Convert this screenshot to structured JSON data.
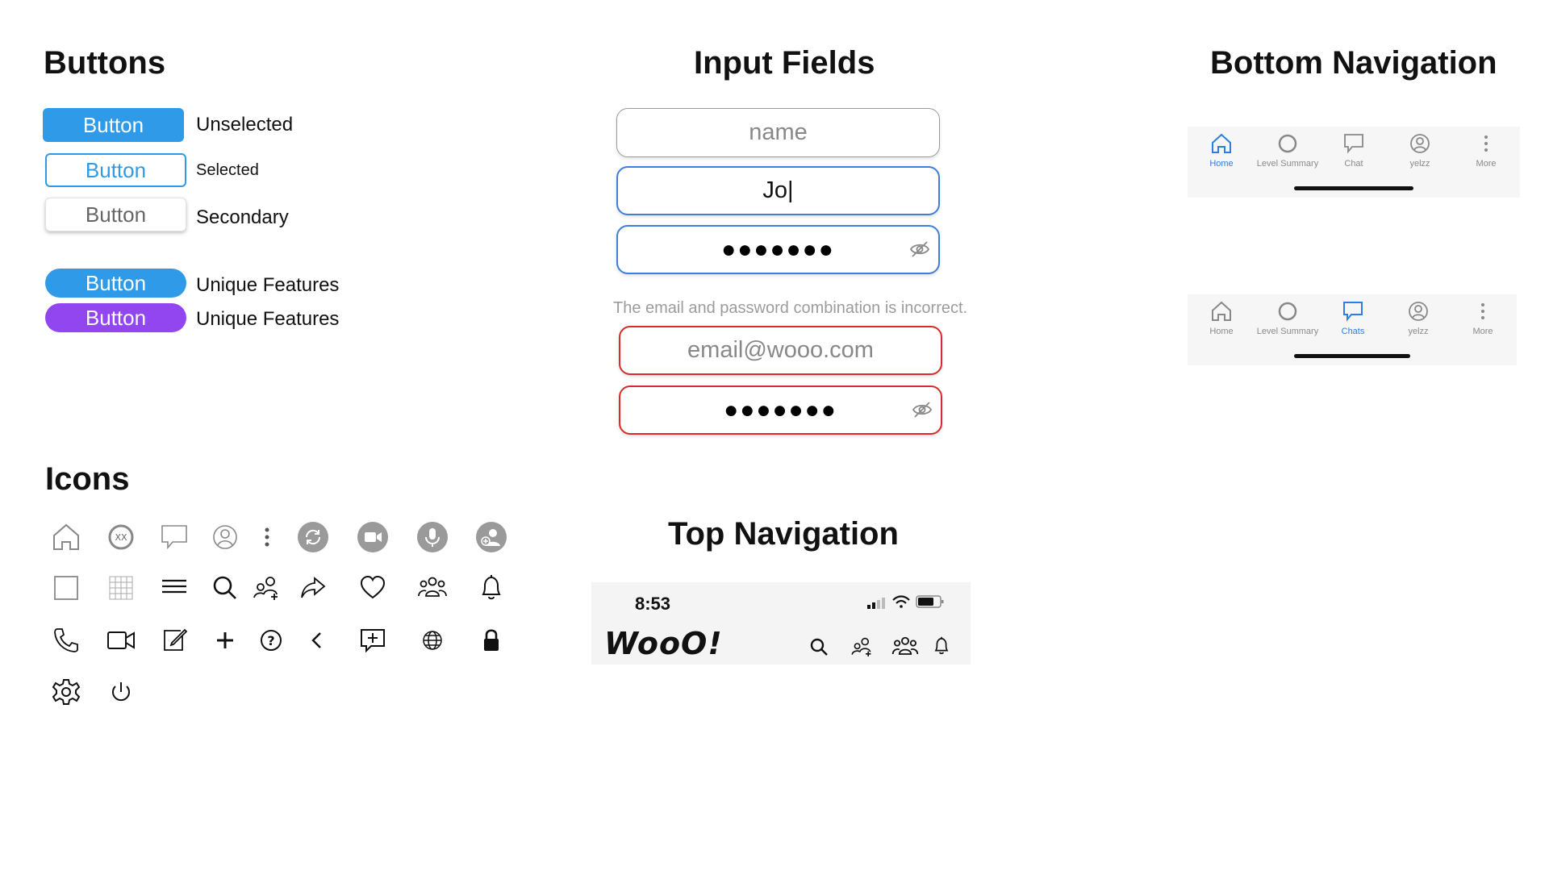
{
  "sections": {
    "buttons": "Buttons",
    "inputs": "Input Fields",
    "bottom_nav": "Bottom Navigation",
    "icons": "Icons",
    "top_nav": "Top Navigation"
  },
  "buttons": [
    {
      "label": "Button",
      "caption": "Unselected"
    },
    {
      "label": "Button",
      "caption": "Selected"
    },
    {
      "label": "Button",
      "caption": "Secondary"
    },
    {
      "label": "Button",
      "caption": "Unique Features"
    },
    {
      "label": "Button",
      "caption": "Unique Features"
    }
  ],
  "inputs": {
    "name_placeholder": "name",
    "typed_value": "Jo|",
    "password_mask": "●●●●●●●",
    "error_message": "The email and password combination is incorrect.",
    "email_placeholder": "email@wooo.com",
    "password_mask_error": "●●●●●●●"
  },
  "bottom_nav": {
    "bar1": [
      "Home",
      "Level Summary",
      "Chat",
      "yelzz",
      "More"
    ],
    "bar2": [
      "Home",
      "Level Summary",
      "Chats",
      "yelzz",
      "More"
    ],
    "active_color": "#2f7de1",
    "inactive_color": "#8a8a8a"
  },
  "top_nav": {
    "time": "8:53",
    "logo": "WooO!"
  },
  "icons": [
    "home-icon",
    "xx-badge-icon",
    "chat-bubble-icon",
    "profile-icon",
    "more-vertical-icon",
    "refresh-circle-icon",
    "video-circle-icon",
    "mic-circle-icon",
    "add-user-circle-icon",
    "square-icon",
    "grid-icon",
    "menu-icon",
    "search-icon",
    "add-friend-icon",
    "share-icon",
    "heart-icon",
    "group-icon",
    "bell-icon",
    "phone-icon",
    "video-camera-icon",
    "edit-icon",
    "plus-icon",
    "help-icon",
    "back-icon",
    "add-comment-icon",
    "globe-icon",
    "lock-icon",
    "settings-icon",
    "power-icon"
  ],
  "colors": {
    "primary": "#2f9be8",
    "purple": "#9146f0",
    "error": "#d92b2b",
    "focus": "#3f7fd9"
  }
}
